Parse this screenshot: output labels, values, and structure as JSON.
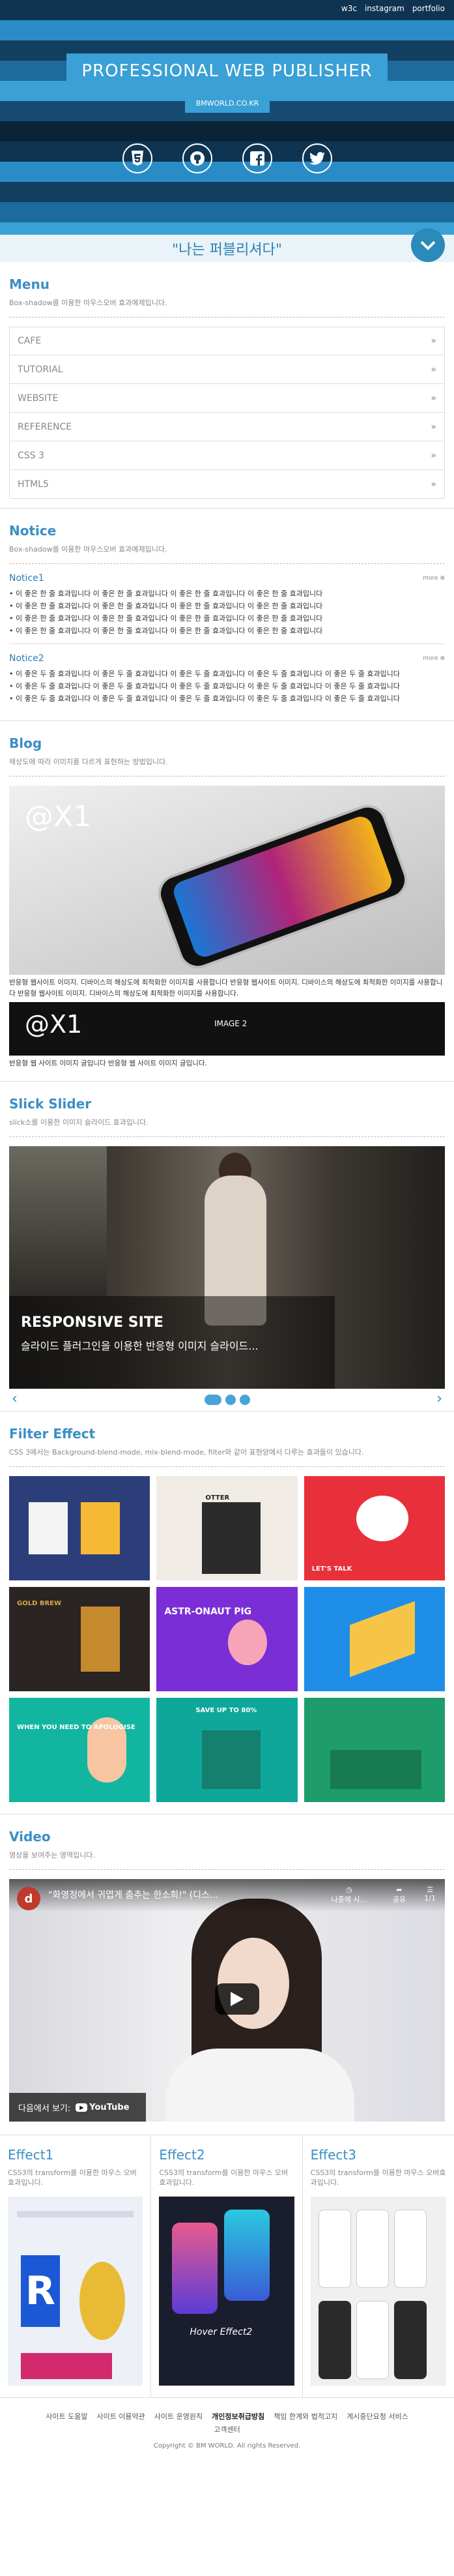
{
  "topnav": [
    "w3c",
    "instagram",
    "portfolio"
  ],
  "header": {
    "title": "PROFESSIONAL WEB PUBLISHER",
    "subtitle": "BMWORLD.CO.KR"
  },
  "social": [
    "html5-icon",
    "github-icon",
    "facebook-icon",
    "twitter-icon"
  ],
  "slogan": "\"나는 퍼블리셔다\"",
  "menu": {
    "title": "Menu",
    "desc": "Box-shadow를 이용한 마우스오버 효과예제입니다.",
    "items": [
      "CAFE",
      "TUTORIAL",
      "WEBSITE",
      "REFERENCE",
      "CSS 3",
      "HTML5"
    ]
  },
  "notice": {
    "title": "Notice",
    "desc": "Box-shadow를 이용한 마우스오버 효과예제입니다.",
    "more": "more ⊕",
    "groups": [
      {
        "title": "Notice1",
        "items": [
          "이 좋은 한 줄 효과입니다 이 좋은 한 줄 효과입니다 이 좋은 한 줄 효과입니다 이 좋은 한 줄 효과입니다",
          "이 좋은 한 줄 효과입니다 이 좋은 한 줄 효과입니다 이 좋은 한 줄 효과입니다 이 좋은 한 줄 효과입니다",
          "이 좋은 한 줄 효과입니다 이 좋은 한 줄 효과입니다 이 좋은 한 줄 효과입니다 이 좋은 한 줄 효과입니다",
          "이 좋은 한 줄 효과입니다 이 좋은 한 줄 효과입니다 이 좋은 한 줄 효과입니다 이 좋은 한 줄 효과입니다"
        ]
      },
      {
        "title": "Notice2",
        "items": [
          "이 좋은 두 줄 효과입니다 이 좋은 두 줄 효과입니다 이 좋은 두 줄 효과입니다 이 좋은 두 줄 효과입니다 이 좋은 두 줄 효과입니다",
          "이 좋은 두 줄 효과입니다 이 좋은 두 줄 효과입니다 이 좋은 두 줄 효과입니다 이 좋은 두 줄 효과입니다 이 좋은 두 줄 효과입니다",
          "이 좋은 두 줄 효과입니다 이 좋은 두 줄 효과입니다 이 좋은 두 줄 효과입니다 이 좋은 두 줄 효과입니다 이 좋은 두 줄 효과입니다"
        ]
      }
    ]
  },
  "blog": {
    "title": "Blog",
    "desc": "해상도에 따라 이미지를 다르게 표현하는 방법입니다.",
    "img_text": "@X1",
    "caption1": "반응형 웹사이트 이미지. 디바이스의 해상도에 최적화한 이미지를 사용합니다 반응형 웹사이트 이미지. 디바이스의 해상도에 최적화한 이미지를 사용합니다 반응형 웹사이트 이미지. 디바이스의 해상도에 최적화한 이미지를 사용합니다.",
    "img2_text": "@X1",
    "img2_label": "IMAGE 2",
    "caption2": "반응형 웹 사이트 이미지 글입니다 반응형 웹 사이트 이미지 글입니다."
  },
  "slick": {
    "title": "Slick Slider",
    "desc": "slick소를 이용한 이미지 슬라이드 효과입니다.",
    "slide_title": "RESPONSIVE SITE",
    "slide_sub": "슬라이드 플러그인을 이용한 반응형 이미지 슬라이드..."
  },
  "filter": {
    "title": "Filter Effect",
    "desc": "CSS 3에서는 Background-blend-mode, mix-blend-mode, filter와 같이 표현양에서 다루는 효과들이 있습니다.",
    "labels": [
      "",
      "OTTER",
      "LET'S TALK",
      "GOLD BREW",
      "ASTR-ONAUT PIG",
      "",
      "WHEN YOU NEED TO APOLOGISE",
      "SAVE UP TO 80%",
      ""
    ]
  },
  "video": {
    "title": "Video",
    "desc": "영상을 보여주는 영역입니다.",
    "vtitle": "\"화영정에서 귀엽게 춤추는 한소희!\" (디스...",
    "ctrl1": "나중에 시...",
    "ctrl2": "공유",
    "ctrl3": "1/1",
    "yt": "다음에서 보기:",
    "ytlogo": "YouTube",
    "channel": "d"
  },
  "effects": [
    {
      "title": "Effect1",
      "desc": "CSS3의 transform를 이용한 마우스 오버효과입니다."
    },
    {
      "title": "Effect2",
      "desc": "CSS3의 transform를 이용한 마우스 오버효과입니다.",
      "img_label": "Hover Effect2"
    },
    {
      "title": "Effect3",
      "desc": "CSS3의 transform를 이용한 마우스 오버효과입니다."
    }
  ],
  "footer": {
    "links": [
      "사이트 도움말",
      "사이트 이용약관",
      "사이트 운영원칙",
      "개인정보취급방침",
      "책임 한계와 법적고지",
      "게시중단요청 서비스",
      "고객센터"
    ],
    "copyright": "Copyright © BM WORLD. All rights Reserved."
  }
}
